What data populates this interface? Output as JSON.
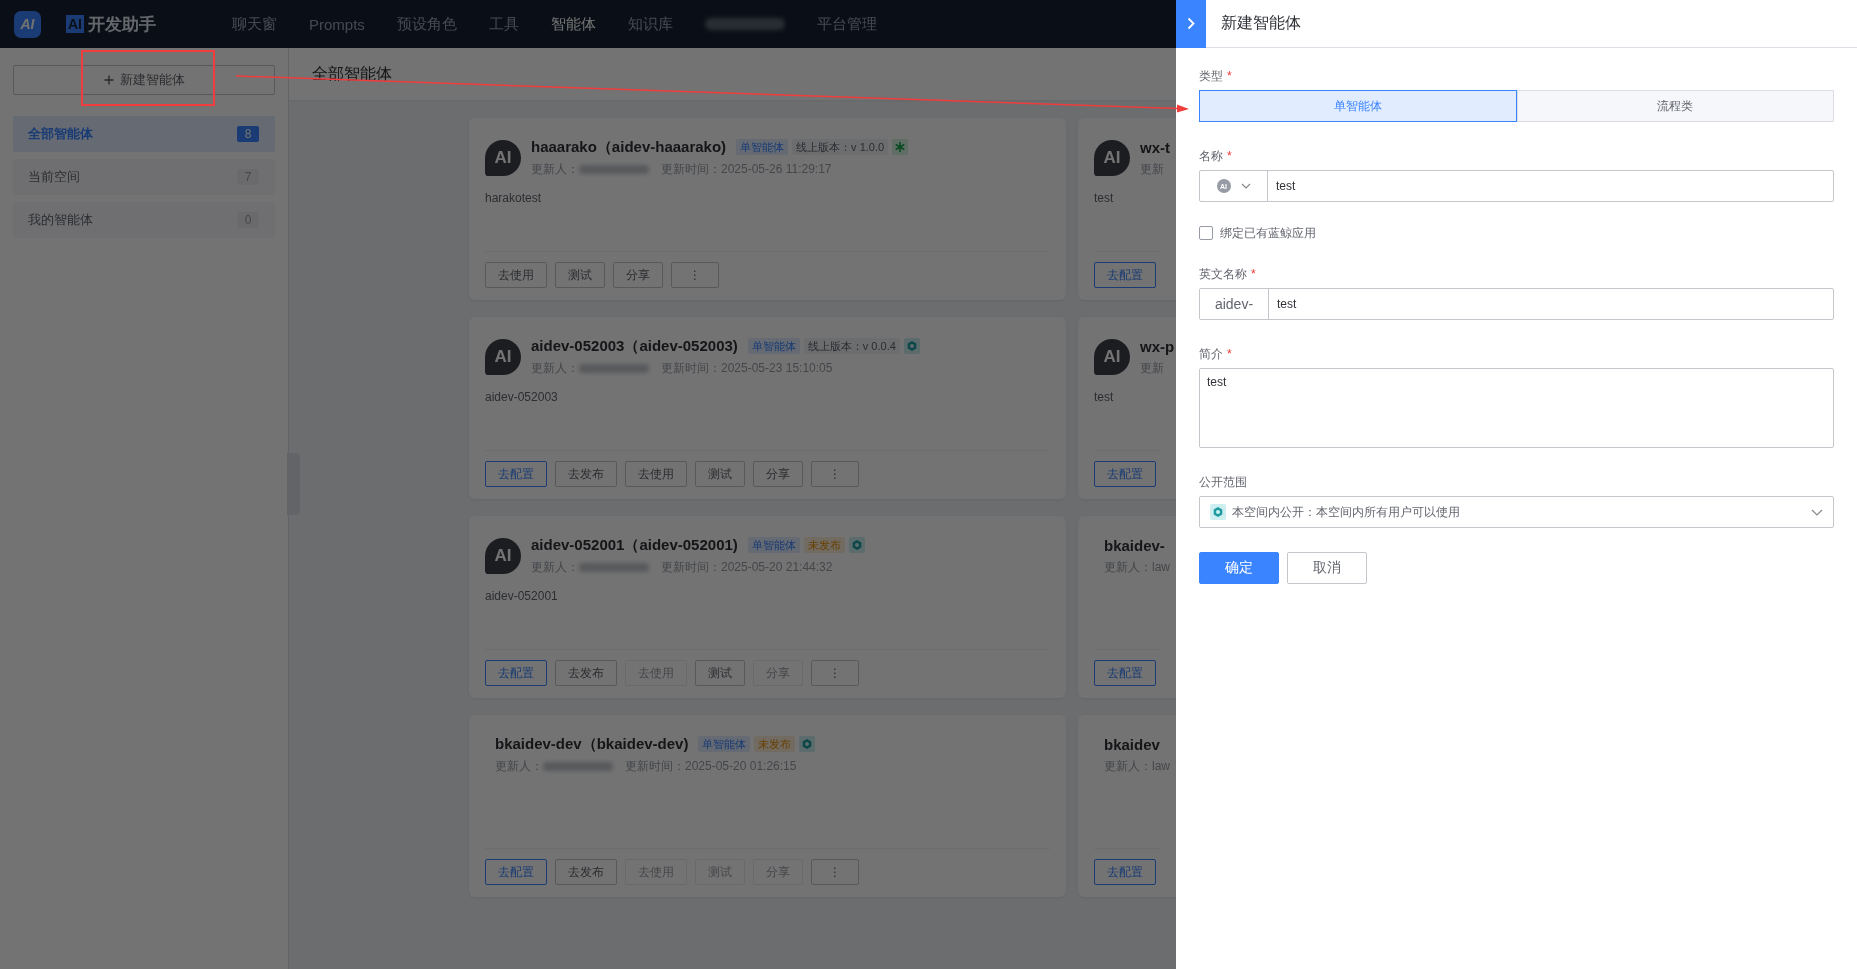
{
  "nav": {
    "logo": "AI",
    "app_badge": "AI",
    "app_name": "开发助手",
    "items": [
      {
        "kind": "link",
        "label": "聊天窗",
        "selected": false
      },
      {
        "kind": "link",
        "label": "Prompts",
        "selected": false
      },
      {
        "kind": "link",
        "label": "预设角色",
        "selected": false
      },
      {
        "kind": "link",
        "label": "工具",
        "selected": false
      },
      {
        "kind": "link",
        "label": "智能体",
        "selected": true
      },
      {
        "kind": "link",
        "label": "知识库",
        "selected": false
      },
      {
        "kind": "blurred"
      },
      {
        "kind": "link",
        "label": "平台管理",
        "selected": false
      }
    ]
  },
  "sidebar": {
    "new_button": "新建智能体",
    "items": [
      {
        "label": "全部智能体",
        "count": "8",
        "selected": true
      },
      {
        "label": "当前空间",
        "count": "7",
        "selected": false
      },
      {
        "label": "我的智能体",
        "count": "0",
        "selected": false
      }
    ]
  },
  "main": {
    "heading": "全部智能体",
    "cards": [
      {
        "avatar": "AI",
        "title": "haaarako（aidev-haaarako)",
        "tags": [
          {
            "kind": "type",
            "text": "单智能体"
          },
          {
            "kind": "version",
            "text": "线上版本：v 1.0.0"
          }
        ],
        "scope": {
          "kind": "asterisk"
        },
        "updater_label": "更新人：",
        "updater_redacted": true,
        "time": "更新时间：2025-05-26 11:29:17",
        "description": "harakotest",
        "buttons": [
          {
            "label": "去使用",
            "primary": false,
            "disabled": false
          },
          {
            "label": "测试",
            "primary": false,
            "disabled": false
          },
          {
            "label": "分享",
            "primary": false,
            "disabled": false
          },
          {
            "label": "⋮",
            "primary": false,
            "disabled": false
          }
        ]
      },
      {
        "avatar": "AI",
        "title": "aidev-052003（aidev-052003)",
        "tags": [
          {
            "kind": "type",
            "text": "单智能体"
          },
          {
            "kind": "version",
            "text": "线上版本：v 0.0.4"
          }
        ],
        "scope": {
          "kind": "hexagon"
        },
        "updater_label": "更新人：",
        "updater_redacted": true,
        "time": "更新时间：2025-05-23 15:10:05",
        "description": "aidev-052003",
        "buttons": [
          {
            "label": "去配置",
            "primary": true,
            "disabled": false
          },
          {
            "label": "去发布",
            "primary": false,
            "disabled": false
          },
          {
            "label": "去使用",
            "primary": false,
            "disabled": false
          },
          {
            "label": "测试",
            "primary": false,
            "disabled": false
          },
          {
            "label": "分享",
            "primary": false,
            "disabled": false
          },
          {
            "label": "⋮",
            "primary": false,
            "disabled": false
          }
        ]
      },
      {
        "avatar": "AI",
        "title": "aidev-052001（aidev-052001)",
        "tags": [
          {
            "kind": "type",
            "text": "单智能体"
          },
          {
            "kind": "unpublished",
            "text": "未发布"
          }
        ],
        "scope": {
          "kind": "hexagon"
        },
        "updater_label": "更新人：",
        "updater_redacted": true,
        "time": "更新时间：2025-05-20 21:44:32",
        "description": "aidev-052001",
        "buttons": [
          {
            "label": "去配置",
            "primary": true,
            "disabled": false
          },
          {
            "label": "去发布",
            "primary": false,
            "disabled": false
          },
          {
            "label": "去使用",
            "primary": false,
            "disabled": true
          },
          {
            "label": "测试",
            "primary": false,
            "disabled": false
          },
          {
            "label": "分享",
            "primary": false,
            "disabled": true
          },
          {
            "label": "⋮",
            "primary": false,
            "disabled": false
          }
        ]
      },
      {
        "title": "bkaidev-dev（bkaidev-dev)",
        "tags": [
          {
            "kind": "type",
            "text": "单智能体"
          },
          {
            "kind": "unpublished",
            "text": "未发布"
          }
        ],
        "scope": {
          "kind": "hexagon"
        },
        "updater_label": "更新人：",
        "updater_redacted": true,
        "time": "更新时间：2025-05-20 01:26:15",
        "buttons": [
          {
            "label": "去配置",
            "primary": true,
            "disabled": false
          },
          {
            "label": "去发布",
            "primary": false,
            "disabled": false
          },
          {
            "label": "去使用",
            "primary": false,
            "disabled": true
          },
          {
            "label": "测试",
            "primary": false,
            "disabled": true
          },
          {
            "label": "分享",
            "primary": false,
            "disabled": true
          },
          {
            "label": "⋮",
            "primary": false,
            "disabled": false
          }
        ]
      }
    ],
    "side_cards": [
      {
        "avatar": "AI",
        "title": "wx-t",
        "updater_label": "更新",
        "description": "test",
        "buttons": [
          {
            "label": "去配置",
            "primary": true,
            "disabled": false
          }
        ]
      },
      {
        "avatar": "AI",
        "title": "wx-p",
        "updater_label": "更新",
        "description": "test",
        "buttons": [
          {
            "label": "去配置",
            "primary": true,
            "disabled": false
          }
        ]
      },
      {
        "title": "bkaidev-",
        "updater_label": "更新人：law",
        "buttons": [
          {
            "label": "去配置",
            "primary": true,
            "disabled": false
          }
        ]
      },
      {
        "title": "bkaidev",
        "updater_label": "更新人：law",
        "buttons": [
          {
            "label": "去配置",
            "primary": true,
            "disabled": false
          }
        ]
      }
    ]
  },
  "drawer": {
    "title": "新建智能体",
    "fields": [
      {
        "kind": "segmented",
        "label": "类型",
        "required_mark": "*",
        "options": [
          {
            "label": "单智能体",
            "selected": true
          },
          {
            "label": "流程类",
            "selected": false
          }
        ]
      },
      {
        "kind": "avatar-input",
        "label": "名称",
        "required_mark": "*",
        "avatar": "AI",
        "value": "test"
      },
      {
        "kind": "checkbox",
        "label": "绑定已有蓝鲸应用",
        "checked": false
      },
      {
        "kind": "prefix-input",
        "label": "英文名称",
        "required_mark": "*",
        "prefix": "aidev-",
        "value": "test"
      },
      {
        "kind": "textarea",
        "label": "简介",
        "required_mark": "*",
        "value": "test"
      },
      {
        "kind": "select",
        "label": "公开范围",
        "value": "本空间内公开：本空间内所有用户可以使用"
      }
    ],
    "buttons": [
      {
        "label": "确定",
        "primary": true
      },
      {
        "label": "取消",
        "primary": false
      }
    ]
  }
}
